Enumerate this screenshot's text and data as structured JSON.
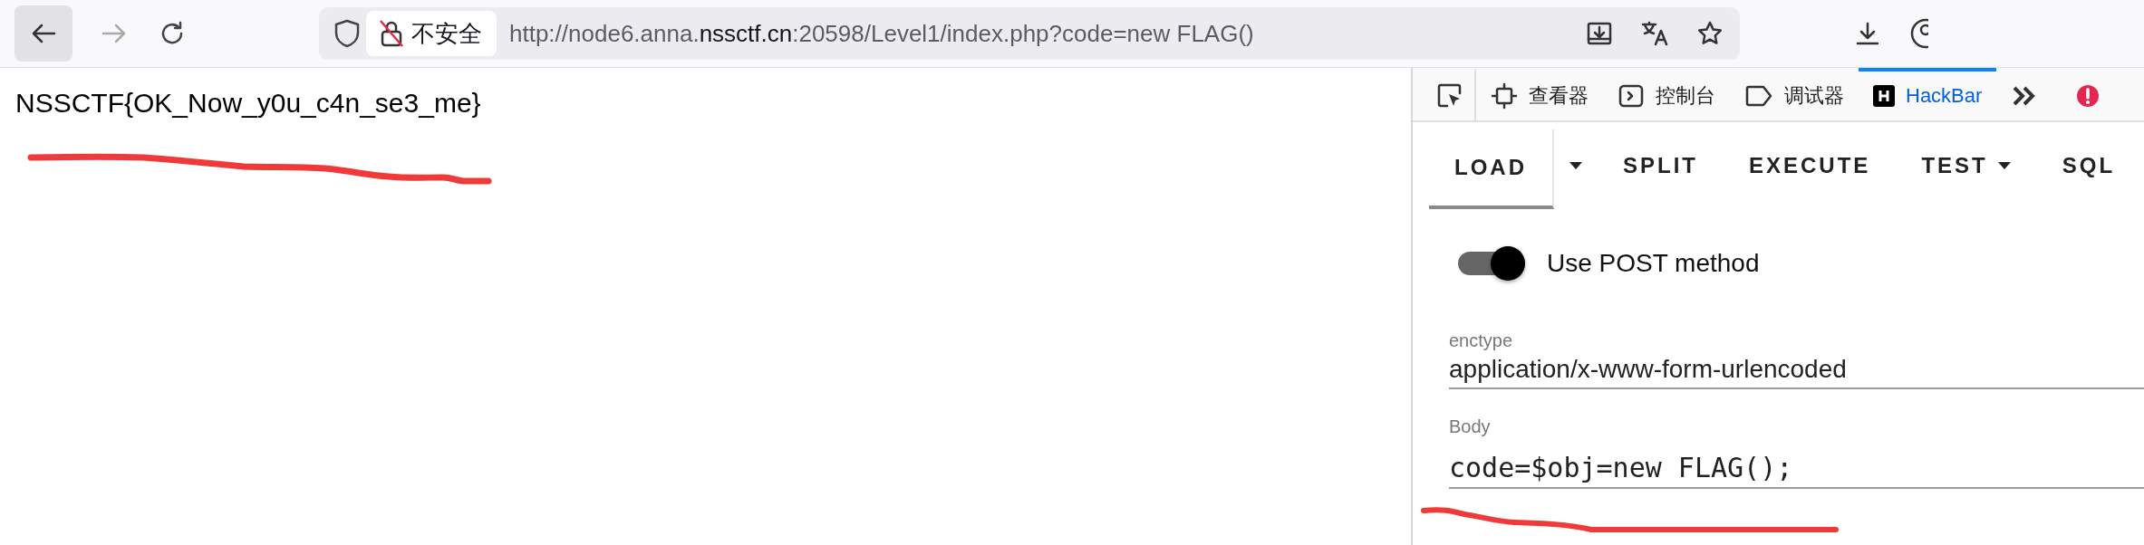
{
  "browser": {
    "security_label": "不安全",
    "url_parts": [
      {
        "text": "http://node6.anna.",
        "emphasis": false
      },
      {
        "text": "nssctf.cn",
        "emphasis": true
      },
      {
        "text": ":20598/Level1/index.php?code=new FLAG()",
        "emphasis": false
      }
    ]
  },
  "page": {
    "text": "NSSCTF{OK_Now_y0u_c4n_se3_me}"
  },
  "devtools": {
    "tabs": [
      {
        "kind": "picker",
        "selected": false
      },
      {
        "kind": "inspector",
        "label": "查看器",
        "selected": false
      },
      {
        "kind": "console",
        "label": "控制台",
        "selected": false
      },
      {
        "kind": "debugger",
        "label": "调试器",
        "selected": false
      },
      {
        "kind": "hackbar",
        "label": "HackBar",
        "selected": true
      },
      {
        "kind": "overflow",
        "selected": false
      },
      {
        "kind": "error",
        "selected": false
      }
    ]
  },
  "hackbar": {
    "buttons": [
      {
        "label": "LOAD",
        "dropdown": false,
        "selected": true
      },
      {
        "dropdown": true,
        "selected": false
      },
      {
        "label": "SPLIT",
        "dropdown": false,
        "selected": false
      },
      {
        "label": "EXECUTE",
        "dropdown": false,
        "selected": false
      },
      {
        "label": "TEST",
        "dropdown": true,
        "selected": false
      },
      {
        "label": "SQL",
        "dropdown": false,
        "selected": false
      }
    ],
    "post_toggle": {
      "label": "Use POST method",
      "on": true
    },
    "fields": [
      {
        "label": "enctype",
        "value": "application/x-www-form-urlencoded",
        "mono": false
      },
      {
        "label": "Body",
        "value": "code=$obj=new FLAG();",
        "mono": true
      }
    ]
  }
}
